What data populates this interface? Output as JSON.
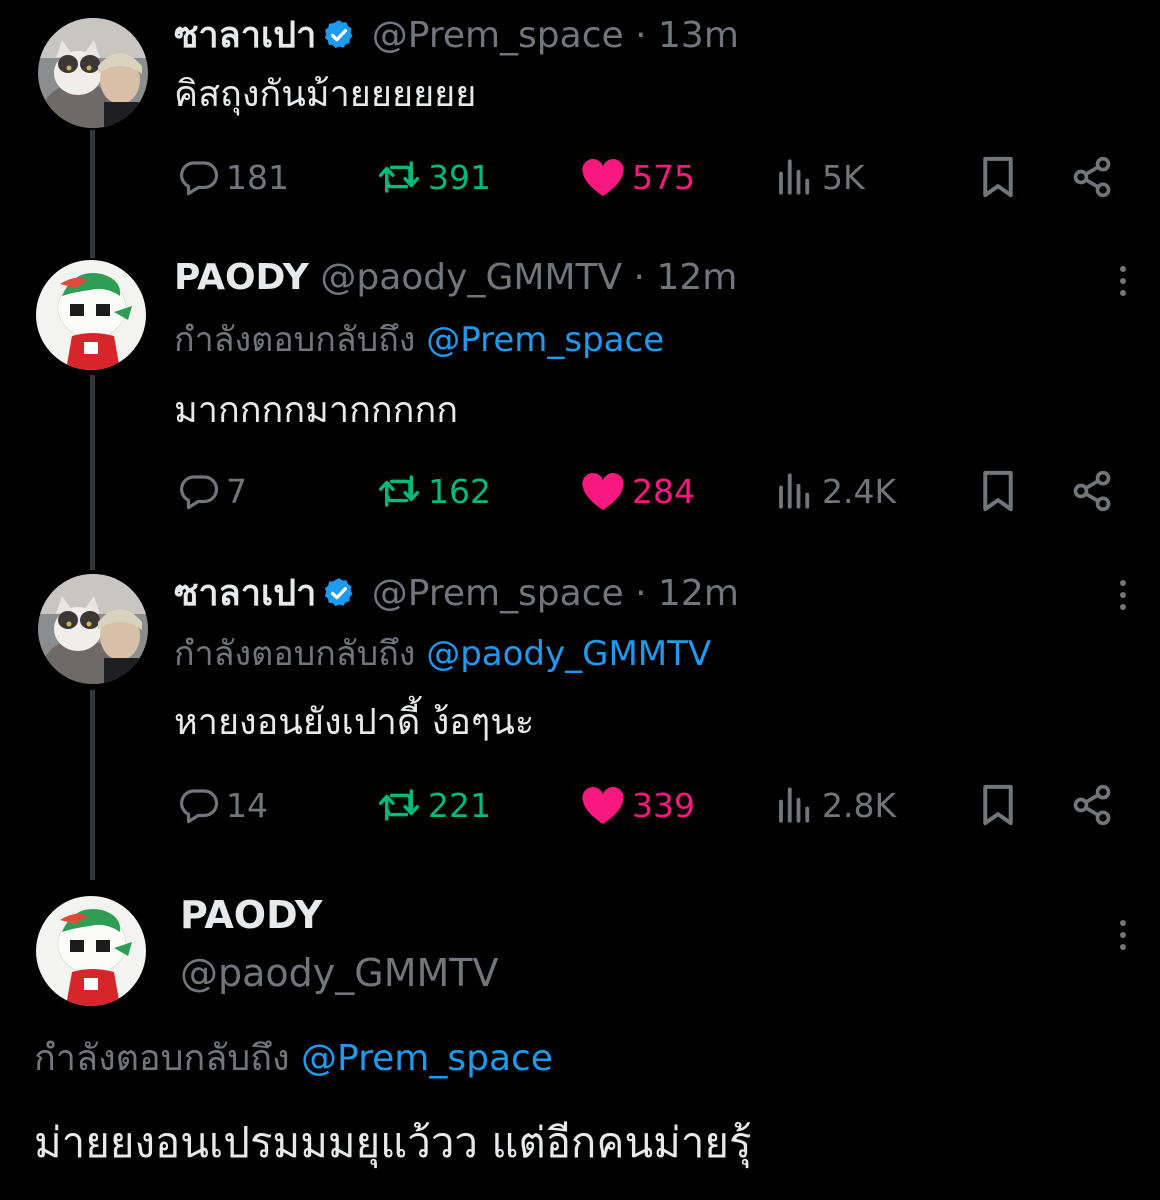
{
  "colors": {
    "background": "#000000",
    "text": "#e7e9ea",
    "muted": "#71767b",
    "accent": "#1d9bf0",
    "retweet": "#00ba7c",
    "like": "#f91880"
  },
  "icons": [
    "reply-icon",
    "retweet-icon",
    "like-heart-icon",
    "views-icon",
    "bookmark-icon",
    "share-icon",
    "verified-badge-icon",
    "more-options-icon"
  ],
  "thread": [
    {
      "name": "ซาลาเปา",
      "verified": true,
      "handle": "@Prem_space",
      "separator": "·",
      "time": "13m",
      "reply_prefix": "",
      "reply_to": "",
      "text": "คิสถุงกันม้ายยยยยย",
      "stats": {
        "replies": "181",
        "retweets": "391",
        "likes": "575",
        "views": "5K"
      }
    },
    {
      "name": "PAODY",
      "verified": false,
      "handle": "@paody_GMMTV",
      "separator": "·",
      "time": "12m",
      "reply_prefix": "กำลังตอบกลับถึง",
      "reply_to": "@Prem_space",
      "text": "มากกกกมากกกกก",
      "stats": {
        "replies": "7",
        "retweets": "162",
        "likes": "284",
        "views": "2.4K"
      }
    },
    {
      "name": "ซาลาเปา",
      "verified": true,
      "handle": "@Prem_space",
      "separator": "·",
      "time": "12m",
      "reply_prefix": "กำลังตอบกลับถึง",
      "reply_to": "@paody_GMMTV",
      "text": "หายงอนยังเปาดี้ ง้อๆนะ",
      "stats": {
        "replies": "14",
        "retweets": "221",
        "likes": "339",
        "views": "2.8K"
      }
    }
  ],
  "main_tweet": {
    "name": "PAODY",
    "handle": "@paody_GMMTV",
    "reply_prefix": "กำลังตอบกลับถึง",
    "reply_to": "@Prem_space",
    "text": "ม่ายยงอนเปรมมมยุแว้วว แต่อีกคนม่ายรุ้"
  }
}
